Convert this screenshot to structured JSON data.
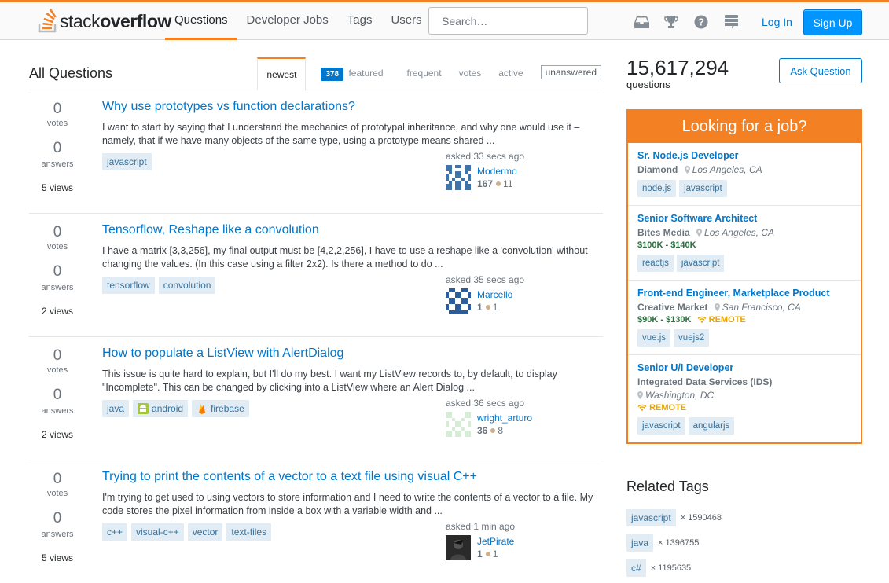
{
  "header": {
    "logo_light": "stack",
    "logo_bold": "overflow",
    "nav": [
      "Questions",
      "Developer Jobs",
      "Tags",
      "Users"
    ],
    "search_placeholder": "Search…",
    "icons": [
      "inbox-icon",
      "trophy-icon",
      "help-icon",
      "stack-exchange-icon"
    ],
    "login": "Log In",
    "signup": "Sign Up"
  },
  "main": {
    "title": "All Questions",
    "tabs": {
      "newest": "newest",
      "featured_count": "378",
      "featured": "featured",
      "frequent": "frequent",
      "votes": "votes",
      "active": "active",
      "unanswered": "unanswered"
    },
    "questions": [
      {
        "votes": "0",
        "votes_label": "votes",
        "answers": "0",
        "answers_label": "answers",
        "views": "5 views",
        "title": "Why use prototypes vs function declarations?",
        "excerpt": "I want to start by saying that I understand the mechanics of prototypal inheritance, and why one would use it – namely, that if we have many objects of the same type, using a prototype means shared ...",
        "tags": [
          "javascript"
        ],
        "asked": "asked 33 secs ago",
        "user": "Modermo",
        "rep": "167",
        "bronze": "11"
      },
      {
        "votes": "0",
        "votes_label": "votes",
        "answers": "0",
        "answers_label": "answers",
        "views": "2 views",
        "title": "Tensorflow, Reshape like a convolution",
        "excerpt": "I have a matrix [3,3,256], my final output must be [4,2,2,256], I have to use a reshape like a 'convolution' without changing the values. (In this case using a filter 2x2). Is there a method to do ...",
        "tags": [
          "tensorflow",
          "convolution"
        ],
        "asked": "asked 35 secs ago",
        "user": "Marcello",
        "rep": "1",
        "bronze": "1"
      },
      {
        "votes": "0",
        "votes_label": "votes",
        "answers": "0",
        "answers_label": "answers",
        "views": "2 views",
        "title": "How to populate a ListView with AlertDialog",
        "excerpt": "This issue is quite hard to explain, but I'll do my best. I want my ListView records to, by default, to display \"Incomplete\". This can be changed by clicking into a ListView where an Alert Dialog ...",
        "tags": [
          "java",
          "android",
          "firebase"
        ],
        "asked": "asked 36 secs ago",
        "user": "wright_arturo",
        "rep": "36",
        "bronze": "8"
      },
      {
        "votes": "0",
        "votes_label": "votes",
        "answers": "0",
        "answers_label": "answers",
        "views": "5 views",
        "title": "Trying to print the contents of a vector to a text file using visual C++",
        "excerpt": "I'm trying to get used to using vectors to store information and I need to write the contents of a vector to a file. My code stores the pixel information from inside a box with a variable width and ...",
        "tags": [
          "c++",
          "visual-c++",
          "vector",
          "text-files"
        ],
        "asked": "asked 1 min ago",
        "user": "JetPirate",
        "rep": "1",
        "bronze": "1"
      }
    ]
  },
  "sidebar": {
    "question_count": "15,617,294",
    "question_label": "questions",
    "ask_button": "Ask Question",
    "jobs_header": "Looking for a job?",
    "jobs": [
      {
        "title": "Sr. Node.js Developer",
        "company": "Diamond",
        "location": "Los Angeles, CA",
        "tags": [
          "node.js",
          "javascript"
        ]
      },
      {
        "title": "Senior Software Architect",
        "company": "Bites Media",
        "location": "Los Angeles, CA",
        "salary": "$100K - $140K",
        "tags": [
          "reactjs",
          "javascript"
        ]
      },
      {
        "title": "Front-end Engineer, Marketplace Product",
        "company": "Creative Market",
        "location": "San Francisco, CA",
        "salary": "$90K - $130K",
        "remote": "REMOTE",
        "tags": [
          "vue.js",
          "vuejs2"
        ]
      },
      {
        "title": "Senior U/I Developer",
        "company": "Integrated Data Services (IDS)",
        "location": "Washington, DC",
        "remote": "REMOTE",
        "tags": [
          "javascript",
          "angularjs"
        ]
      }
    ],
    "related_title": "Related Tags",
    "related": [
      {
        "tag": "javascript",
        "count": "× 1590468"
      },
      {
        "tag": "java",
        "count": "× 1396755"
      },
      {
        "tag": "c#",
        "count": "× 1195635"
      }
    ]
  },
  "colors": {
    "accent": "#f48024",
    "link": "#0077cc",
    "tag_bg": "#e1ecf4",
    "tag_text": "#39739d",
    "primary_button": "#0095ff"
  }
}
